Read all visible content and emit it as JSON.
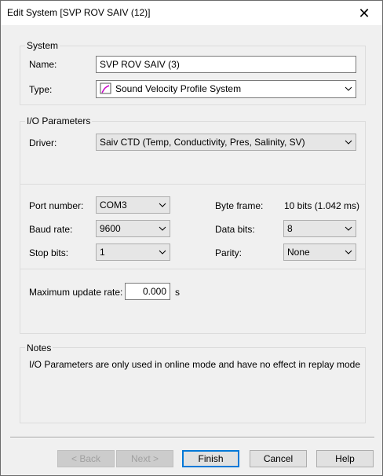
{
  "window": {
    "title": "Edit System [SVP ROV SAIV (12)]",
    "close_glyph": "✕"
  },
  "system": {
    "group_label": "System",
    "name_label": "Name:",
    "name_value": "SVP ROV SAIV (3)",
    "type_label": "Type:",
    "type_value": "Sound Velocity Profile System",
    "type_icon": "svp-icon"
  },
  "io": {
    "group_label": "I/O Parameters",
    "driver_label": "Driver:",
    "driver_value": "Saiv CTD (Temp, Conductivity, Pres, Salinity, SV)",
    "port_label": "Port number:",
    "port_value": "COM3",
    "baud_label": "Baud rate:",
    "baud_value": "9600",
    "stop_label": "Stop bits:",
    "stop_value": "1",
    "byteframe_label": "Byte frame:",
    "byteframe_value": "10 bits (1.042 ms)",
    "databits_label": "Data bits:",
    "databits_value": "8",
    "parity_label": "Parity:",
    "parity_value": "None",
    "maxrate_label": "Maximum update rate:",
    "maxrate_value": "0.000",
    "maxrate_unit": "s"
  },
  "notes": {
    "group_label": "Notes",
    "text": "I/O Parameters are only used in online mode and have no effect in replay mode"
  },
  "buttons": {
    "back": "< Back",
    "next": "Next >",
    "finish": "Finish",
    "cancel": "Cancel",
    "help": "Help"
  }
}
